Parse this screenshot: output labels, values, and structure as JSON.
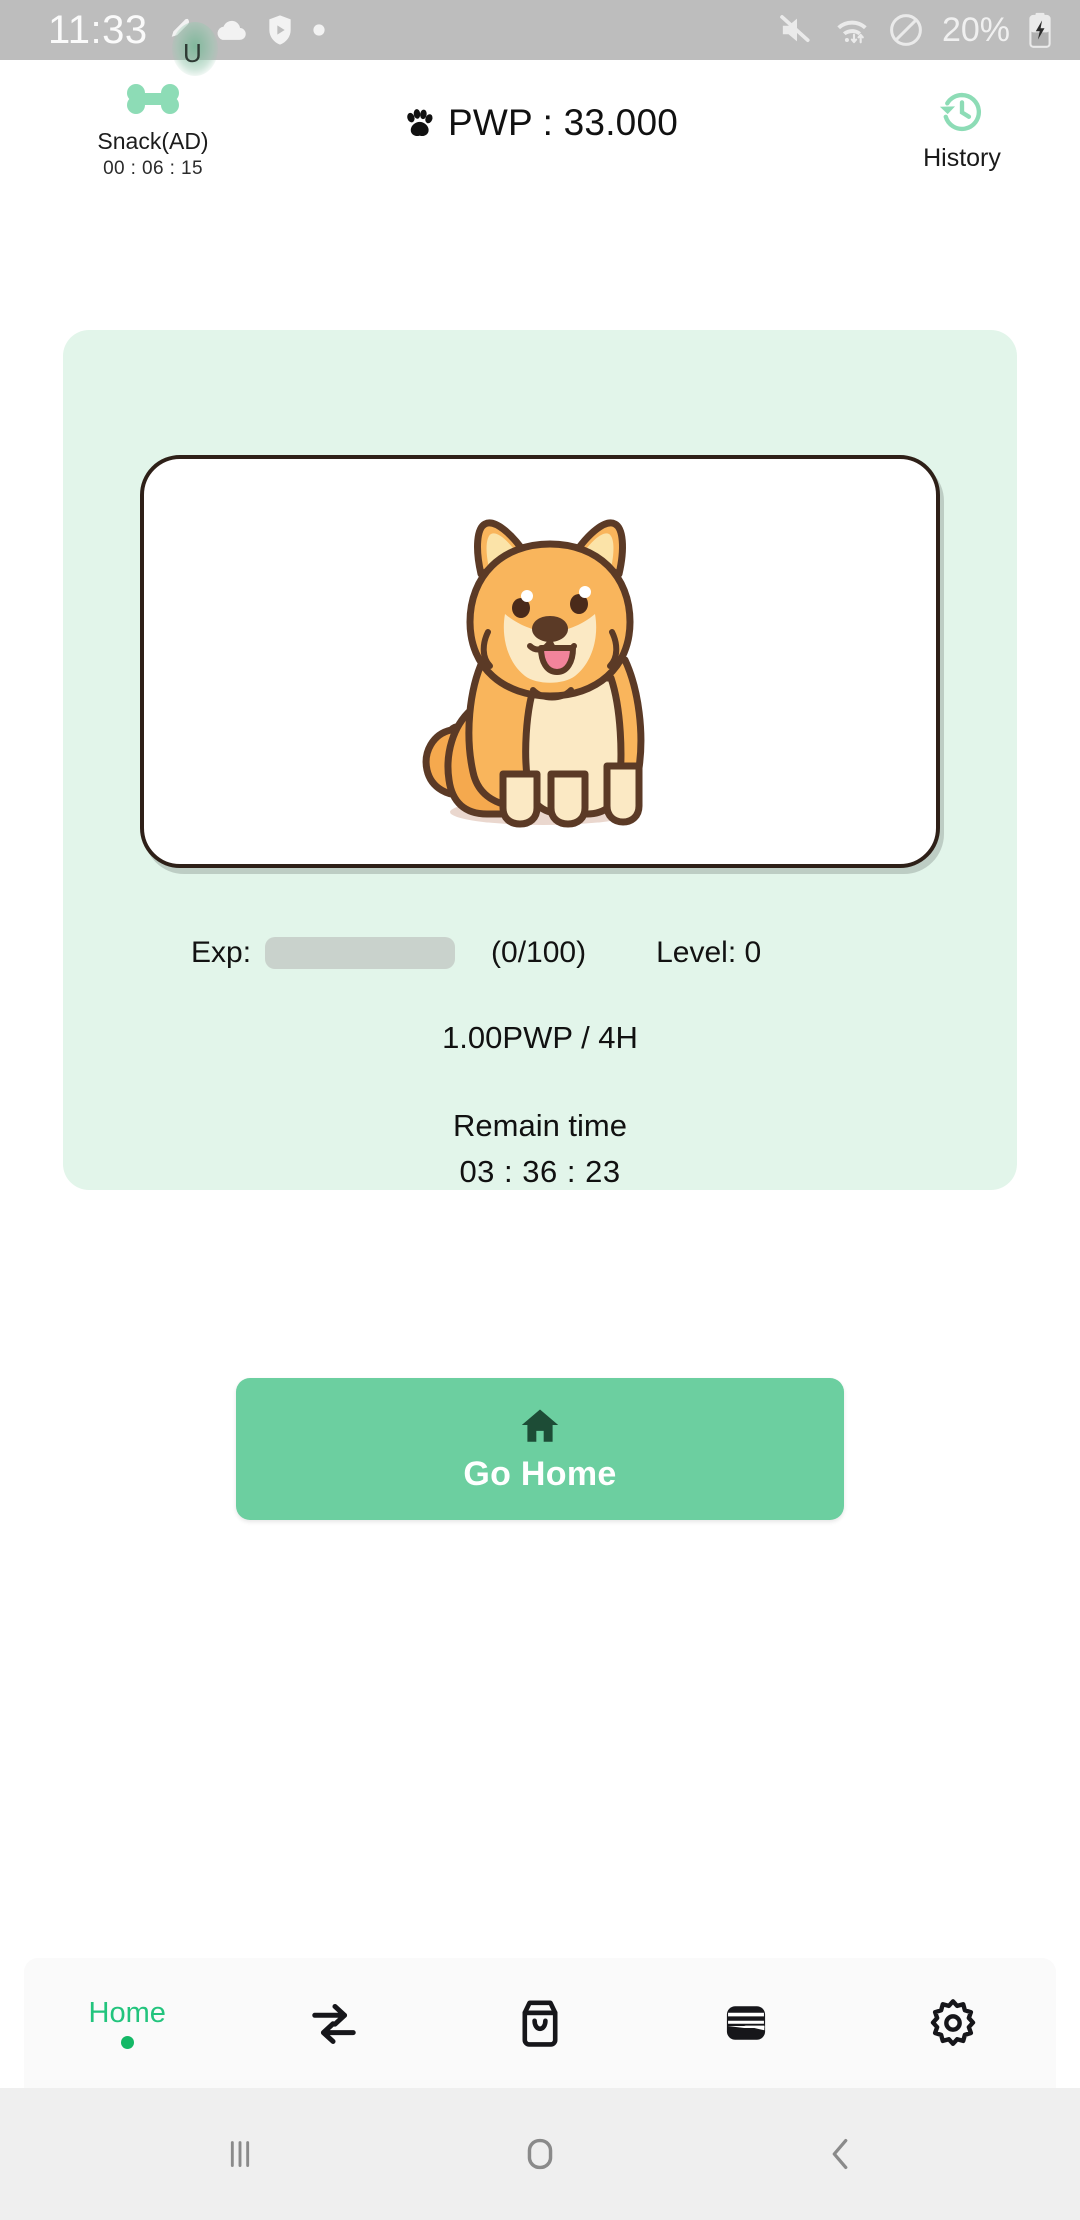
{
  "status_bar": {
    "clock": "11:33",
    "battery_percent": "20%",
    "icons": [
      "pen-highlight-icon",
      "cloud-icon",
      "play-shield-icon",
      "dot-icon",
      "mute-icon",
      "wifi-icon",
      "do-not-disturb-icon",
      "battery-charging-icon"
    ],
    "background_color": "#bdbdbd"
  },
  "header": {
    "snack": {
      "label": "Snack(AD)",
      "timer": "00 : 06 : 15",
      "icon": "bone-icon",
      "icon_color": "#8ddcb6"
    },
    "balance": {
      "icon": "paw-icon",
      "text": "PWP : 33.000"
    },
    "history": {
      "label": "History",
      "icon": "history-clock-icon",
      "icon_color": "#8ddcb6"
    }
  },
  "pet_card": {
    "background_color": "#e2f5ea",
    "pet_image": "shiba-inu-illustration",
    "exp": {
      "label": "Exp:",
      "count": "(0/100)",
      "level": "Level: 0",
      "progress_percent": 0,
      "bar_empty_color": "#c9d2cc"
    },
    "rate": "1.00PWP / 4H",
    "remain_title": "Remain time",
    "remain_time": "03 : 36 : 23"
  },
  "go_home_button": {
    "label": "Go Home",
    "icon": "home-icon",
    "background_color": "#6ccfa0",
    "text_color": "#ffffff"
  },
  "bottom_nav": {
    "active_color": "#22c47d",
    "items": [
      {
        "label": "Home",
        "icon": "home-label-active",
        "active": true
      },
      {
        "label": "",
        "icon": "swap-arrows-icon",
        "active": false
      },
      {
        "label": "",
        "icon": "shopping-bag-icon",
        "active": false
      },
      {
        "label": "",
        "icon": "wallet-icon",
        "active": false
      },
      {
        "label": "",
        "icon": "gear-icon",
        "active": false
      }
    ]
  },
  "system_nav": {
    "recents": "recents-icon",
    "home": "home-square-icon",
    "back": "back-chevron-icon"
  }
}
